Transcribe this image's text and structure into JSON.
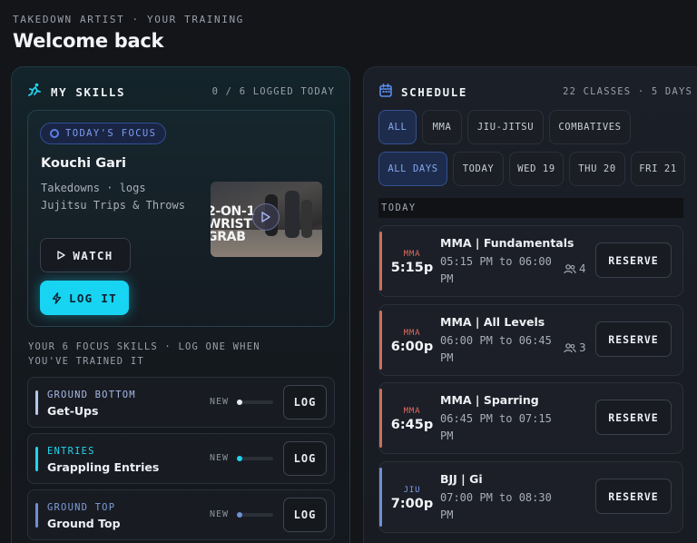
{
  "header": {
    "eyebrow": "TAKEDOWN ARTIST · YOUR TRAINING",
    "title": "Welcome back"
  },
  "skills_panel": {
    "icon": "athlete-icon",
    "title": "MY SKILLS",
    "meta": "0 / 6 LOGGED TODAY",
    "focus": {
      "chip": "TODAY'S FOCUS",
      "skill_name": "Kouchi Gari",
      "description": "Takedowns · logs Jujitsu Trips & Throws",
      "video_caption_line1": "2-ON-1",
      "video_caption_line2": "WRIST",
      "video_caption_line3": "GRAB",
      "watch_label": "WATCH",
      "log_label": "LOG IT"
    },
    "focus_note": "YOUR 6 FOCUS SKILLS · LOG ONE WHEN YOU'VE TRAINED IT",
    "rows": [
      {
        "category": "GROUND BOTTOM",
        "name": "Get-Ups",
        "status": "NEW",
        "progress": 0,
        "color": "#b9c6ea",
        "log_label": "LOG"
      },
      {
        "category": "ENTRIES",
        "name": "Grappling Entries",
        "status": "NEW",
        "progress": 0,
        "color": "#22d3ee",
        "log_label": "LOG"
      },
      {
        "category": "GROUND TOP",
        "name": "Ground Top",
        "status": "NEW",
        "progress": 0,
        "color": "#6f8fd6",
        "log_label": "LOG"
      }
    ]
  },
  "schedule_panel": {
    "icon": "calendar-icon",
    "title": "SCHEDULE",
    "meta": "22 CLASSES · 5 DAYS",
    "disciplines": [
      "ALL",
      "MMA",
      "JIU-JITSU",
      "COMBATIVES"
    ],
    "days": [
      "ALL DAYS",
      "TODAY",
      "WED 19",
      "THU 20",
      "FRI 21"
    ],
    "active_discipline": "ALL",
    "active_day": "ALL DAYS",
    "day_label": "TODAY",
    "classes": [
      {
        "tag": "MMA",
        "time": "5:15p",
        "name": "MMA | Fundamentals",
        "range": "05:15 PM to 06:00 PM",
        "count": "4",
        "reserve": "RESERVE",
        "color": "#e06b5e"
      },
      {
        "tag": "MMA",
        "time": "6:00p",
        "name": "MMA | All Levels",
        "range": "06:00 PM to 06:45 PM",
        "count": "3",
        "reserve": "RESERVE",
        "color": "#e06b5e"
      },
      {
        "tag": "MMA",
        "time": "6:45p",
        "name": "MMA | Sparring",
        "range": "06:45 PM to 07:15 PM",
        "count": "",
        "reserve": "RESERVE",
        "color": "#e06b5e"
      },
      {
        "tag": "JIU",
        "time": "7:00p",
        "name": "BJJ | Gi",
        "range": "07:00 PM to 08:30 PM",
        "count": "",
        "reserve": "RESERVE",
        "color": "#7f9cf0"
      }
    ]
  }
}
